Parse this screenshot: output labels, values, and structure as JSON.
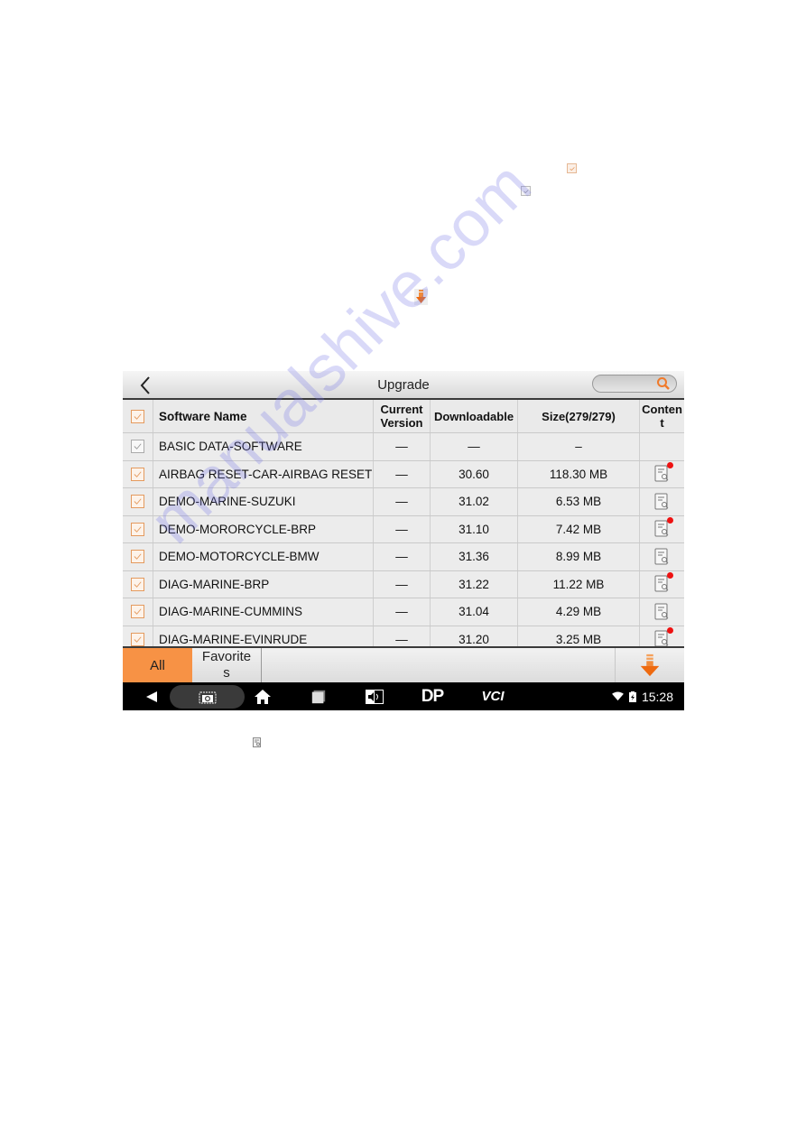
{
  "document": {
    "inline_icons": [
      {
        "name": "orange-checkbox-icon"
      },
      {
        "name": "gray-checkbox-icon"
      },
      {
        "name": "download-arrow-icon"
      },
      {
        "name": "content-doc-icon"
      }
    ]
  },
  "app": {
    "title": "Upgrade",
    "search": {
      "placeholder": "",
      "value": ""
    },
    "table": {
      "headers": [
        "Software Name",
        "Current Version",
        "Downloadable",
        "Size(279/279)",
        "Content"
      ],
      "header_checked": true,
      "rows": [
        {
          "name": "BASIC DATA-SOFTWARE",
          "current": "—",
          "downloadable": "—",
          "size": "–",
          "checked": true,
          "style": "gray",
          "content": false,
          "new": false
        },
        {
          "name": "AIRBAG RESET-CAR-AIRBAG RESET",
          "current": "—",
          "downloadable": "30.60",
          "size": "118.30 MB",
          "checked": true,
          "style": "orange",
          "content": true,
          "new": true
        },
        {
          "name": "DEMO-MARINE-SUZUKI",
          "current": "—",
          "downloadable": "31.02",
          "size": "6.53 MB",
          "checked": true,
          "style": "orange",
          "content": true,
          "new": false
        },
        {
          "name": "DEMO-MORORCYCLE-BRP",
          "current": "—",
          "downloadable": "31.10",
          "size": "7.42 MB",
          "checked": true,
          "style": "orange",
          "content": true,
          "new": true
        },
        {
          "name": "DEMO-MOTORCYCLE-BMW",
          "current": "—",
          "downloadable": "31.36",
          "size": "8.99 MB",
          "checked": true,
          "style": "orange",
          "content": true,
          "new": false
        },
        {
          "name": "DIAG-MARINE-BRP",
          "current": "—",
          "downloadable": "31.22",
          "size": "11.22 MB",
          "checked": true,
          "style": "orange",
          "content": true,
          "new": true
        },
        {
          "name": "DIAG-MARINE-CUMMINS",
          "current": "—",
          "downloadable": "31.04",
          "size": "4.29 MB",
          "checked": true,
          "style": "orange",
          "content": true,
          "new": false
        },
        {
          "name": "DIAG-MARINE-EVINRUDE",
          "current": "—",
          "downloadable": "31.20",
          "size": "3.25 MB",
          "checked": true,
          "style": "orange",
          "content": true,
          "new": true
        }
      ]
    },
    "tabs": [
      {
        "label": "All",
        "active": true
      },
      {
        "label": "Favorites",
        "active": false
      }
    ],
    "navbar": {
      "dp_label": "DP",
      "vci_label": "VCI",
      "time": "15:28"
    },
    "colors": {
      "accent": "#f79245",
      "new_dot": "#ee1111",
      "navbar": "#000000"
    }
  },
  "watermark": "manualshive.com"
}
